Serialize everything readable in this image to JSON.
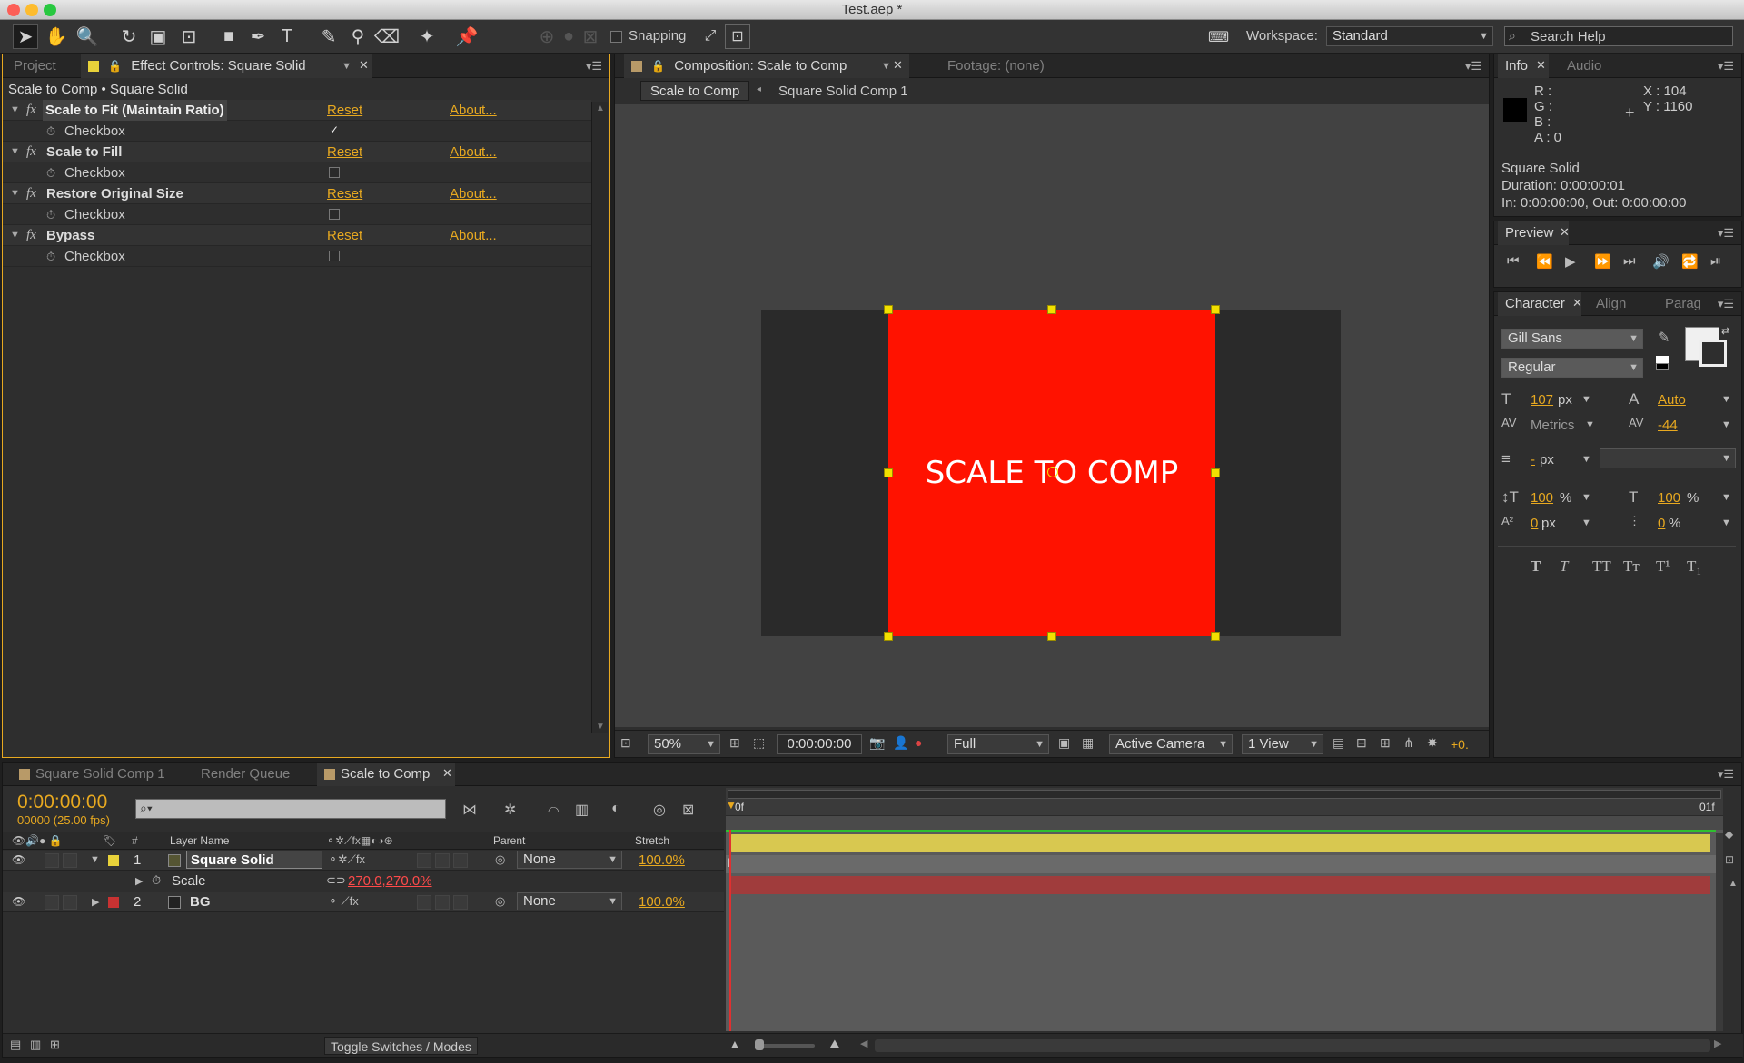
{
  "window": {
    "title": "Test.aep *"
  },
  "toolbar": {
    "snapping_label": "Snapping",
    "workspace_label": "Workspace:",
    "workspace_value": "Standard",
    "search_placeholder": "Search Help"
  },
  "left_panel": {
    "tabs": [
      {
        "label": "Project"
      },
      {
        "label": "Effect Controls: Square Solid"
      }
    ],
    "breadcrumb": "Scale to Comp • Square Solid",
    "reset_label": "Reset",
    "about_label": "About...",
    "fx_label": "fx",
    "effects": [
      {
        "name": "Scale to Fit (Maintain Ratio)",
        "param": "Checkbox",
        "checked": true
      },
      {
        "name": "Scale to Fill",
        "param": "Checkbox",
        "checked": false
      },
      {
        "name": "Restore Original Size",
        "param": "Checkbox",
        "checked": false
      },
      {
        "name": "Bypass",
        "param": "Checkbox",
        "checked": false
      }
    ]
  },
  "comp_panel": {
    "tabs": [
      {
        "label": "Composition: Scale to Comp"
      },
      {
        "label": "Footage: (none)"
      }
    ],
    "nav": [
      {
        "label": "Scale to Comp"
      },
      {
        "label": "Square Solid Comp 1"
      }
    ],
    "canvas_text": "SCALE TO COMP",
    "bottom": {
      "zoom": "50%",
      "timecode": "0:00:00:00",
      "resolution": "Full",
      "camera": "Active Camera",
      "views": "1 View",
      "exposure": "+0."
    },
    "colors": {
      "solid": "#ff1200",
      "comp_bg": "#2a2a2a",
      "viewer_bg": "#424242"
    }
  },
  "info_panel": {
    "tabs": [
      {
        "label": "Info"
      },
      {
        "label": "Audio"
      }
    ],
    "r": "R :",
    "g": "G :",
    "b": "B :",
    "a": "A : 0",
    "x": "X : 104",
    "y": "Y : 1160",
    "layer_name": "Square Solid",
    "duration": "Duration: 0:00:00:01",
    "inout": "In: 0:00:00:00, Out: 0:00:00:00"
  },
  "preview_panel": {
    "tabs": [
      {
        "label": "Preview"
      }
    ]
  },
  "character_panel": {
    "tabs": [
      {
        "label": "Character"
      },
      {
        "label": "Align"
      },
      {
        "label": "Parag"
      }
    ],
    "font_family": "Gill Sans",
    "font_style": "Regular",
    "font_size": "107",
    "leading": "Auto",
    "kerning": "Metrics",
    "tracking": "-44",
    "stroke_width": "-",
    "vert_scale": "100",
    "horiz_scale": "100",
    "baseline_shift": "0",
    "tsume": "0",
    "unit_px": "px",
    "unit_pct": "%",
    "style_buttons": [
      {
        "label": "T"
      },
      {
        "label": "T"
      },
      {
        "label": "TT"
      },
      {
        "label": "Tт"
      },
      {
        "label": "T¹"
      },
      {
        "label": "T₁"
      }
    ]
  },
  "timeline": {
    "tabs": [
      {
        "label": "Square Solid Comp 1"
      },
      {
        "label": "Render Queue"
      },
      {
        "label": "Scale to Comp"
      }
    ],
    "timecode": "0:00:00:00",
    "frame_info": "00000 (25.00 fps)",
    "columns": {
      "hash": "#",
      "layer_name": "Layer Name",
      "parent": "Parent",
      "stretch": "Stretch"
    },
    "ruler_start": "0f",
    "ruler_end": "01f",
    "layers": [
      {
        "index": "1",
        "name": "Square Solid",
        "parent": "None",
        "stretch": "100.0%",
        "label_color": "#e8d23a"
      },
      {
        "index": "2",
        "name": "BG",
        "parent": "None",
        "stretch": "100.0%",
        "label_color": "#c83232"
      }
    ],
    "scale_property": {
      "name": "Scale",
      "value": "270.0,270.0%"
    },
    "toggle_label": "Toggle Switches / Modes"
  }
}
